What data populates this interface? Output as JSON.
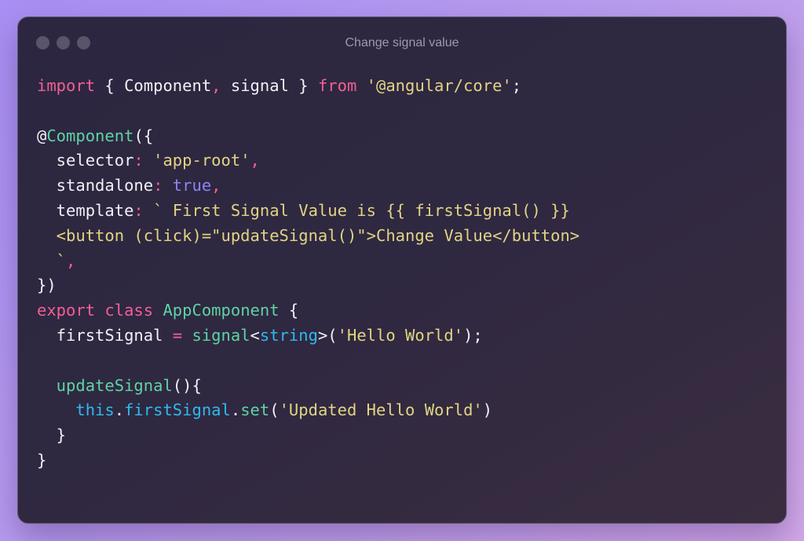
{
  "window": {
    "title": "Change signal value",
    "controls": [
      "window-dot-1",
      "window-dot-2",
      "window-dot-3"
    ]
  },
  "theme": {
    "background_gradient": [
      "#a78ff3",
      "#d2a9e8"
    ],
    "window_bg": "#2c2640",
    "keyword": "#f25f95",
    "string": "#e2d483",
    "function": "#5fd3a3",
    "boolean": "#8a86f0",
    "type": "#2fb9ee",
    "text": "#f2f0f6"
  },
  "code": {
    "language": "typescript",
    "lines": [
      [
        [
          "kw",
          "import"
        ],
        [
          "plain",
          " { Component"
        ],
        [
          "pn",
          ","
        ],
        [
          "plain",
          " signal } "
        ],
        [
          "kw",
          "from"
        ],
        [
          "plain",
          " "
        ],
        [
          "str",
          "'@angular/core'"
        ],
        [
          "plain",
          ";"
        ]
      ],
      [],
      [
        [
          "plain",
          "@"
        ],
        [
          "fn",
          "Component"
        ],
        [
          "plain",
          "({"
        ]
      ],
      [
        [
          "plain",
          "  selector"
        ],
        [
          "pn",
          ":"
        ],
        [
          "plain",
          " "
        ],
        [
          "str",
          "'app-root'"
        ],
        [
          "pn",
          ","
        ]
      ],
      [
        [
          "plain",
          "  standalone"
        ],
        [
          "pn",
          ":"
        ],
        [
          "plain",
          " "
        ],
        [
          "bool",
          "true"
        ],
        [
          "pn",
          ","
        ]
      ],
      [
        [
          "plain",
          "  template"
        ],
        [
          "pn",
          ":"
        ],
        [
          "plain",
          " "
        ],
        [
          "str",
          "` First Signal Value is {{ firstSignal() }}"
        ]
      ],
      [
        [
          "str",
          "  <button (click)=\"updateSignal()\">Change Value</button>"
        ]
      ],
      [
        [
          "str",
          "  `"
        ],
        [
          "pn",
          ","
        ]
      ],
      [
        [
          "plain",
          "})"
        ]
      ],
      [
        [
          "kw",
          "export"
        ],
        [
          "plain",
          " "
        ],
        [
          "kw",
          "class"
        ],
        [
          "plain",
          " "
        ],
        [
          "fn",
          "AppComponent"
        ],
        [
          "plain",
          " {"
        ]
      ],
      [
        [
          "plain",
          "  firstSignal "
        ],
        [
          "pn",
          "="
        ],
        [
          "plain",
          " "
        ],
        [
          "fn",
          "signal"
        ],
        [
          "plain",
          "<"
        ],
        [
          "type",
          "string"
        ],
        [
          "plain",
          ">("
        ],
        [
          "str",
          "'Hello World'"
        ],
        [
          "plain",
          ");"
        ]
      ],
      [],
      [
        [
          "fn",
          "  updateSignal"
        ],
        [
          "plain",
          "(){"
        ]
      ],
      [
        [
          "plain",
          "    "
        ],
        [
          "type",
          "this"
        ],
        [
          "plain",
          "."
        ],
        [
          "type",
          "firstSignal"
        ],
        [
          "plain",
          "."
        ],
        [
          "fn",
          "set"
        ],
        [
          "plain",
          "("
        ],
        [
          "str",
          "'Updated Hello World'"
        ],
        [
          "plain",
          ")"
        ]
      ],
      [
        [
          "plain",
          "  }"
        ]
      ],
      [
        [
          "plain",
          "}"
        ]
      ]
    ]
  }
}
